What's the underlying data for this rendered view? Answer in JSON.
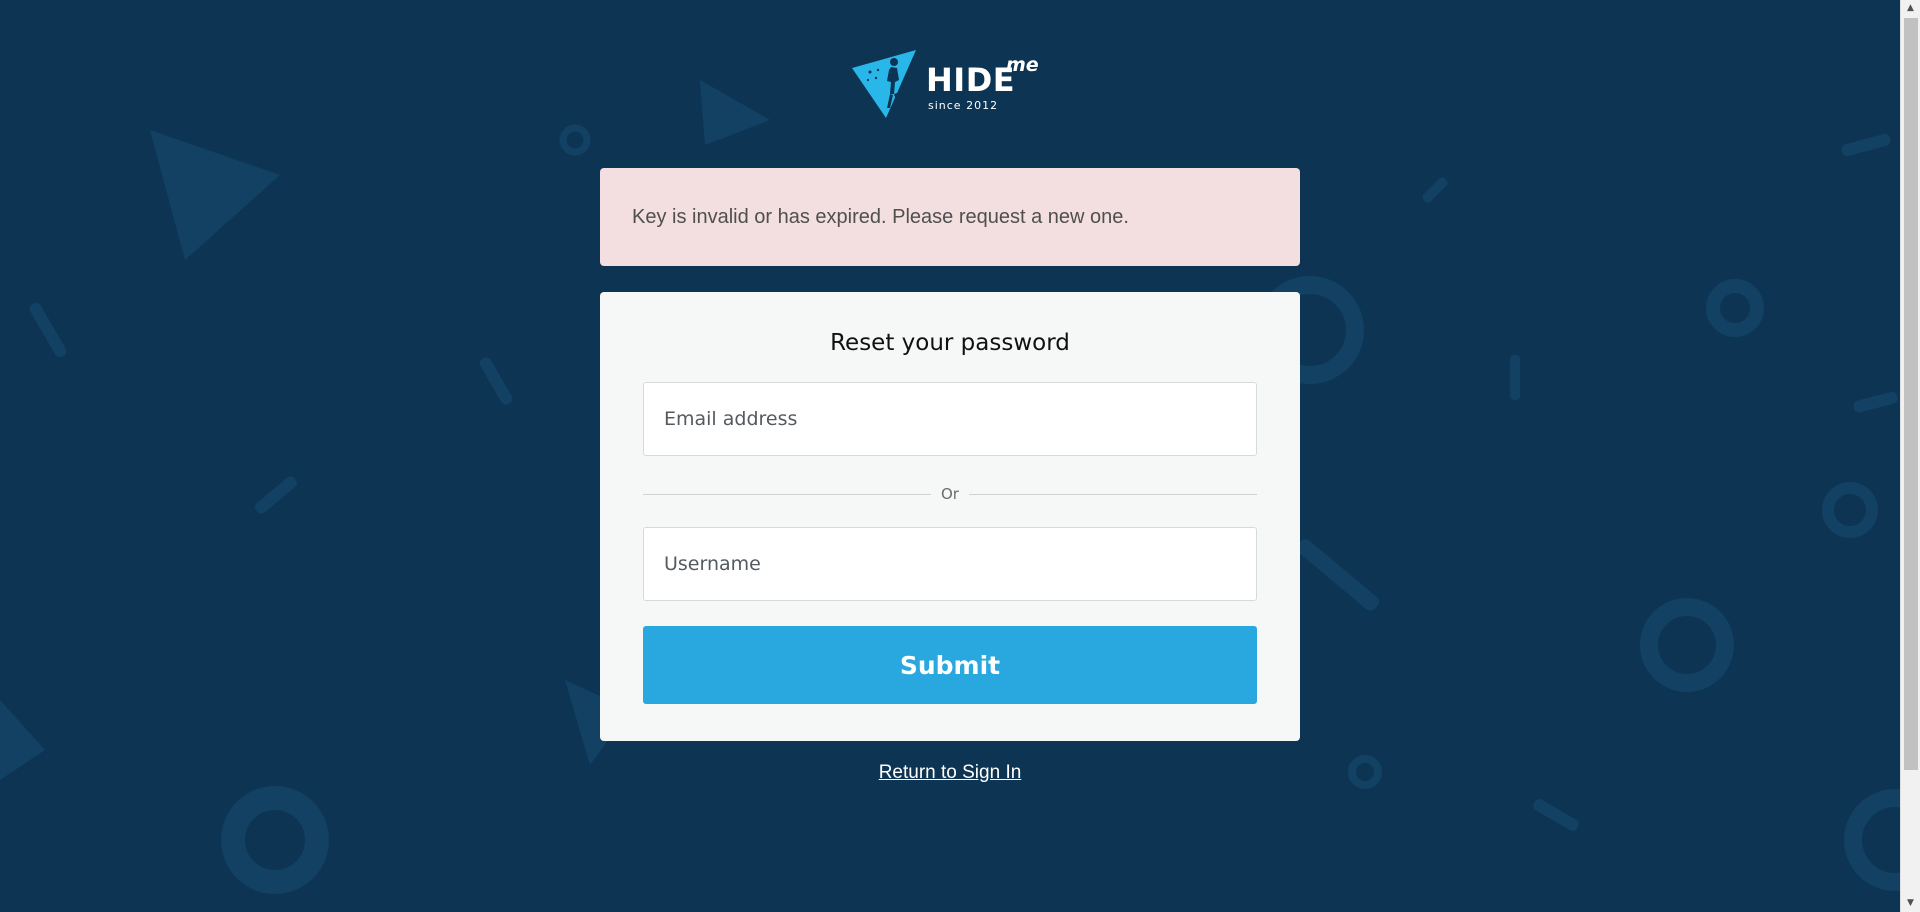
{
  "logo": {
    "brand": "HIDE",
    "brand_suffix": "me",
    "tagline": "since 2012",
    "icon": "hideme-triangle-logo-icon"
  },
  "alert": {
    "message": "Key is invalid or has expired. Please request a new one."
  },
  "form": {
    "title": "Reset your password",
    "email_placeholder": "Email address",
    "divider_label": "Or",
    "username_placeholder": "Username",
    "submit_label": "Submit"
  },
  "links": {
    "return_label": "Return to Sign In"
  },
  "colors": {
    "background": "#0d3553",
    "accent": "#29a8e0",
    "alert_background": "#f3dfe0",
    "card_background": "#f6f8f8"
  }
}
